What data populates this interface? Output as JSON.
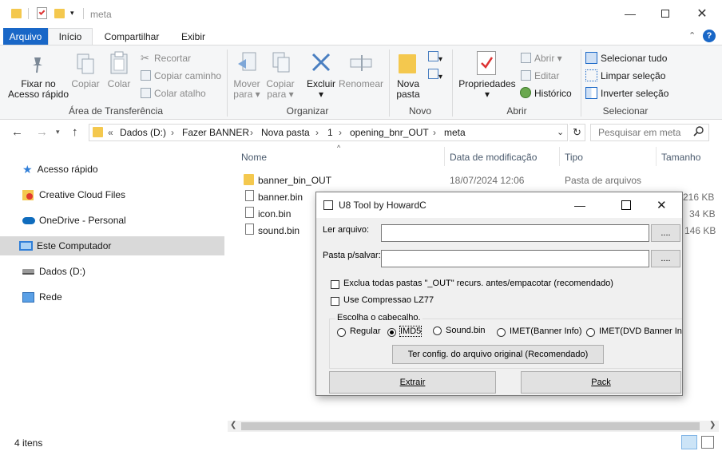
{
  "window": {
    "title": "meta"
  },
  "ribbon_tabs": {
    "file": "Arquivo",
    "home": "Início",
    "share": "Compartilhar",
    "view": "Exibir"
  },
  "ribbon": {
    "pin": "Fixar no\nAcesso rápido",
    "pin_l1": "Fixar no",
    "pin_l2": "Acesso rápido",
    "copy": "Copiar",
    "paste": "Colar",
    "cut": "Recortar",
    "copy_path": "Copiar caminho",
    "paste_shortcut": "Colar atalho",
    "clipboard_group": "Área de Transferência",
    "move_to_l1": "Mover",
    "move_to_l2": "para",
    "copy_to_l1": "Copiar",
    "copy_to_l2": "para",
    "delete": "Excluir",
    "rename": "Renomear",
    "organize_group": "Organizar",
    "new_folder_l1": "Nova",
    "new_folder_l2": "pasta",
    "new_group": "Novo",
    "properties": "Propriedades",
    "open": "Abrir",
    "edit": "Editar",
    "history": "Histórico",
    "open_group": "Abrir",
    "select_all": "Selecionar tudo",
    "select_none": "Limpar seleção",
    "invert_selection": "Inverter seleção",
    "select_group": "Selecionar"
  },
  "address": {
    "crumbs": [
      "Dados (D:)",
      "Fazer BANNER",
      "Nova pasta",
      "1",
      "opening_bnr_OUT",
      "meta"
    ],
    "overflow": "«",
    "search_placeholder": "Pesquisar em meta"
  },
  "nav": {
    "items": [
      "Acesso rápido",
      "Creative Cloud Files",
      "OneDrive - Personal",
      "Este Computador",
      "Dados (D:)",
      "Rede"
    ]
  },
  "columns": {
    "name": "Nome",
    "date": "Data de modificação",
    "type": "Tipo",
    "size": "Tamanho"
  },
  "files": [
    {
      "name": "banner_bin_OUT",
      "date": "18/07/2024 12:06",
      "type": "Pasta de arquivos",
      "size": ""
    },
    {
      "name": "banner.bin",
      "date": "",
      "type": "",
      "size": "216 KB"
    },
    {
      "name": "icon.bin",
      "date": "",
      "type": "",
      "size": "34 KB"
    },
    {
      "name": "sound.bin",
      "date": "",
      "type": "",
      "size": "146 KB"
    }
  ],
  "status": {
    "count": "4 itens"
  },
  "dialog": {
    "title": "U8 Tool by HowardC",
    "read_label": "Ler arquivo:",
    "save_label": "Pasta p/salvar:",
    "read_value": "",
    "save_value": "",
    "browse": "....",
    "opt_exclude": "Exclua todas pastas  \"_OUT\" recurs. antes/empacotar  (recomendado)",
    "opt_lz77": "Use Compressao LZ77",
    "header_group": "Escolha o cabecalho.",
    "radios": [
      "Regular",
      "IMD5",
      "Sound.bin",
      "IMET(Banner Info)",
      "IMET(DVD Banner In"
    ],
    "selected_radio": "IMD5",
    "orig_config": "Ter config. do arquivo original (Recomendado)",
    "extract": "Extrair",
    "pack": "Pack"
  },
  "colors": {
    "accent": "#1967c7",
    "folder": "#f4c84e",
    "selected_nav": "#d9d9d9"
  }
}
